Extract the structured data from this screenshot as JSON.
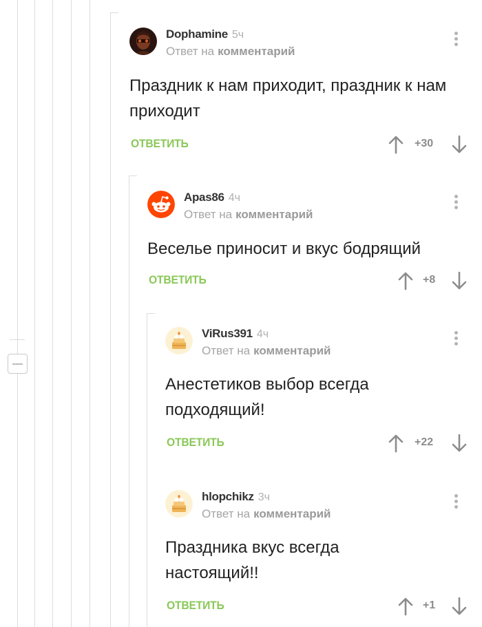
{
  "comments": [
    {
      "author": "Dophamine",
      "time": "5ч",
      "reply_prefix": "Ответ на",
      "reply_target": "комментарий",
      "text": "Праздник к нам приходит, праздник к нам приходит",
      "reply_label": "ОТВЕТИТЬ",
      "score": "+30",
      "avatar_icon": "portrait-avatar-icon"
    },
    {
      "author": "Apas86",
      "time": "4ч",
      "reply_prefix": "Ответ на",
      "reply_target": "комментарий",
      "text": "Веселье приносит и вкус бодрящий",
      "reply_label": "ОТВЕТИТЬ",
      "score": "+8",
      "avatar_icon": "reddit-alien-icon"
    },
    {
      "author": "ViRus391",
      "time": "4ч",
      "reply_prefix": "Ответ на",
      "reply_target": "комментарий",
      "text": "Анестетиков выбор всегда подходящий!",
      "reply_label": "ОТВЕТИТЬ",
      "score": "+22",
      "avatar_icon": "default-cake-avatar-icon"
    },
    {
      "author": "hlopchikz",
      "time": "3ч",
      "reply_prefix": "Ответ на",
      "reply_target": "комментарий",
      "text": "Праздника вкус всегда настоящий!!",
      "reply_label": "ОТВЕТИТЬ",
      "score": "+1",
      "avatar_icon": "default-cake-avatar-icon"
    }
  ],
  "colors": {
    "accent_green": "#8ac858",
    "reddit_orange": "#ff4500",
    "thread_line": "#dcdcdc"
  }
}
